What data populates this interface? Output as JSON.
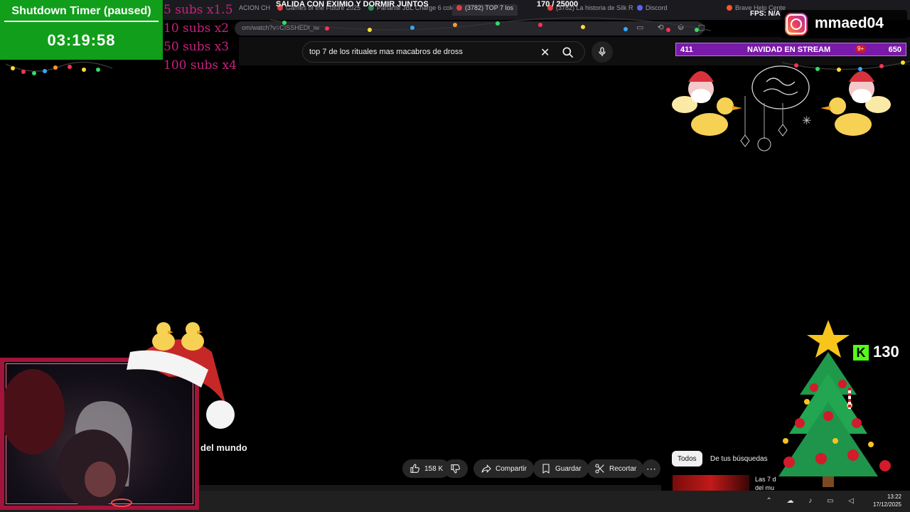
{
  "timer": {
    "title": "Shutdown Timer (paused)",
    "time": "03:19:58"
  },
  "subs_multipliers": [
    "5 subs x1.5",
    "10 subs x2",
    "50 subs x3",
    "100 subs x4"
  ],
  "stream_goal": "SALIDA CON EXIMIO Y DORMIR JUNTOS",
  "goal_counter": "170   /  25000",
  "tabs": [
    {
      "label": "ACION CH",
      "color": "#888888"
    },
    {
      "label": "Games of the Future 2025",
      "color": "#e23d3d"
    },
    {
      "label": "Parlante JBL Charge 6 colo",
      "color": "#2e8b57"
    },
    {
      "label": "(3782) TOP 7 los",
      "color": "#e23d3d"
    },
    {
      "label": "(3782) La historia de Silk R",
      "color": "#e23d3d"
    },
    {
      "label": "Discord",
      "color": "#5865f2"
    },
    {
      "label": "Brave Help Cente",
      "color": "#fb542b"
    }
  ],
  "url": "om/watch?v=CISSHEDf_lw",
  "fps_label": "FPS: N/A",
  "instagram": {
    "username": "mmaed04"
  },
  "event_bar": {
    "left_count": "411",
    "title": "NAVIDAD EN STREAM",
    "right_count": "650",
    "notif_badge": "9+"
  },
  "youtube": {
    "search_query": "top 7 de los rituales mas macabros de dross",
    "video_title_fragment": "del mundo",
    "actions": {
      "likes": "158 K",
      "share": "Compartir",
      "save": "Guardar",
      "clip": "Recortar"
    },
    "chips": {
      "all": "Todos",
      "history": "De tus búsquedas"
    },
    "sidebar_item_title": "Las 7 d del mu"
  },
  "kick_viewers": "130",
  "kick_letter": "K",
  "taskbar": {
    "time": "13:22",
    "date": "17/12/2025"
  },
  "colors": {
    "timer_green": "#119e1b",
    "subs_pink": "#c8217d",
    "event_purple": "#7a1aa8",
    "cam_border": "#a3143a",
    "kick_green": "#53fc18"
  }
}
